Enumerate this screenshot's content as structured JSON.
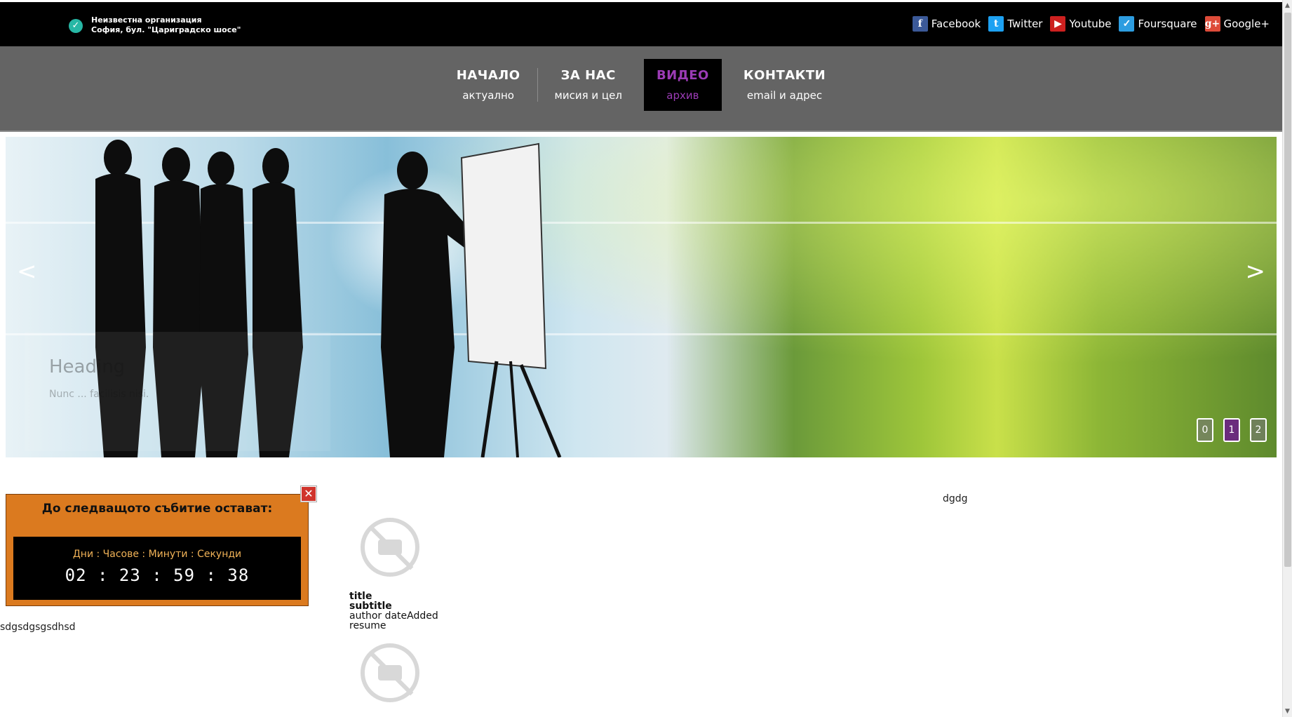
{
  "header": {
    "org_name": "Неизвестна организация",
    "org_address": "София, бул. \"Цариградско шосе\"",
    "social": [
      {
        "label": "Facebook",
        "icon": "facebook-icon",
        "glyph": "f",
        "color": "#3b5998"
      },
      {
        "label": "Twitter",
        "icon": "twitter-icon",
        "glyph": "t",
        "color": "#1da1f2"
      },
      {
        "label": "Youtube",
        "icon": "youtube-icon",
        "glyph": "▶",
        "color": "#cd201f"
      },
      {
        "label": "Foursquare",
        "icon": "foursquare-icon",
        "glyph": "✓",
        "color": "#2d9de0"
      },
      {
        "label": "Google+",
        "icon": "googleplus-icon",
        "glyph": "g+",
        "color": "#dd4b39"
      }
    ]
  },
  "nav": {
    "items": [
      {
        "main": "НАЧАЛО",
        "sub": "актуално",
        "active": false
      },
      {
        "main": "ЗА НАС",
        "sub": "мисия и цел",
        "active": false
      },
      {
        "main": "ВИДЕО",
        "sub": "архив",
        "active": true
      },
      {
        "main": "КОНТАКТИ",
        "sub": "email и адрес",
        "active": false
      }
    ]
  },
  "slider": {
    "caption_title": "Heading",
    "caption_sub": "Nunc ... facilisis nisi.",
    "prev_label": "<",
    "next_label": ">",
    "pages": [
      "0",
      "1",
      "2"
    ],
    "active_page": 1
  },
  "countdown": {
    "title": "До следващото събитие остават:",
    "labels": "Дни : Часове : Минути : Секунди",
    "digits": "02 : 23 : 59 : 38",
    "close": "✕",
    "accent": "#db7a1f"
  },
  "left_text": "sdgsdgsgsdhsd",
  "right_text": "dgdg",
  "article": {
    "title": "title",
    "subtitle": "subtitle",
    "author_date": "author dateAdded",
    "resume": "resume"
  }
}
